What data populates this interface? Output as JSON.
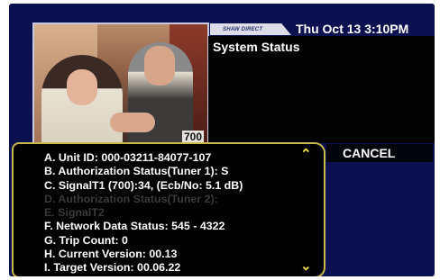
{
  "header": {
    "logo_text": "SHAW DIRECT",
    "datetime": "Thu Oct 13 3:10PM"
  },
  "video": {
    "channel_number": "700"
  },
  "status_panel": {
    "title": "System Status"
  },
  "info_items": [
    {
      "text": "A. Unit ID: 000-03211-84077-107",
      "enabled": true
    },
    {
      "text": "B. Authorization Status(Tuner 1): S",
      "enabled": true
    },
    {
      "text": "C. SignalT1 (700):34, (Ecb/No: 5.1 dB)",
      "enabled": true
    },
    {
      "text": "D. Authorization Status(Tuner 2):",
      "enabled": false
    },
    {
      "text": "E. SignalT2",
      "enabled": false
    },
    {
      "text": "F. Network Data Status: 545 - 4322",
      "enabled": true
    },
    {
      "text": "G. Trip Count: 0",
      "enabled": true
    },
    {
      "text": "H. Current Version: 00.13",
      "enabled": true
    },
    {
      "text": "I. Target Version: 00.06.22",
      "enabled": true
    }
  ],
  "buttons": {
    "cancel_label": "CANCEL"
  },
  "icons": {
    "scroll_up": "chevron-up-icon",
    "scroll_down": "chevron-down-icon"
  },
  "colors": {
    "background": "#0b1150",
    "panel": "#010101",
    "accent_border": "#c8b94a",
    "arrow": "#f0dc3a",
    "disabled_text": "#3a3a3a"
  }
}
